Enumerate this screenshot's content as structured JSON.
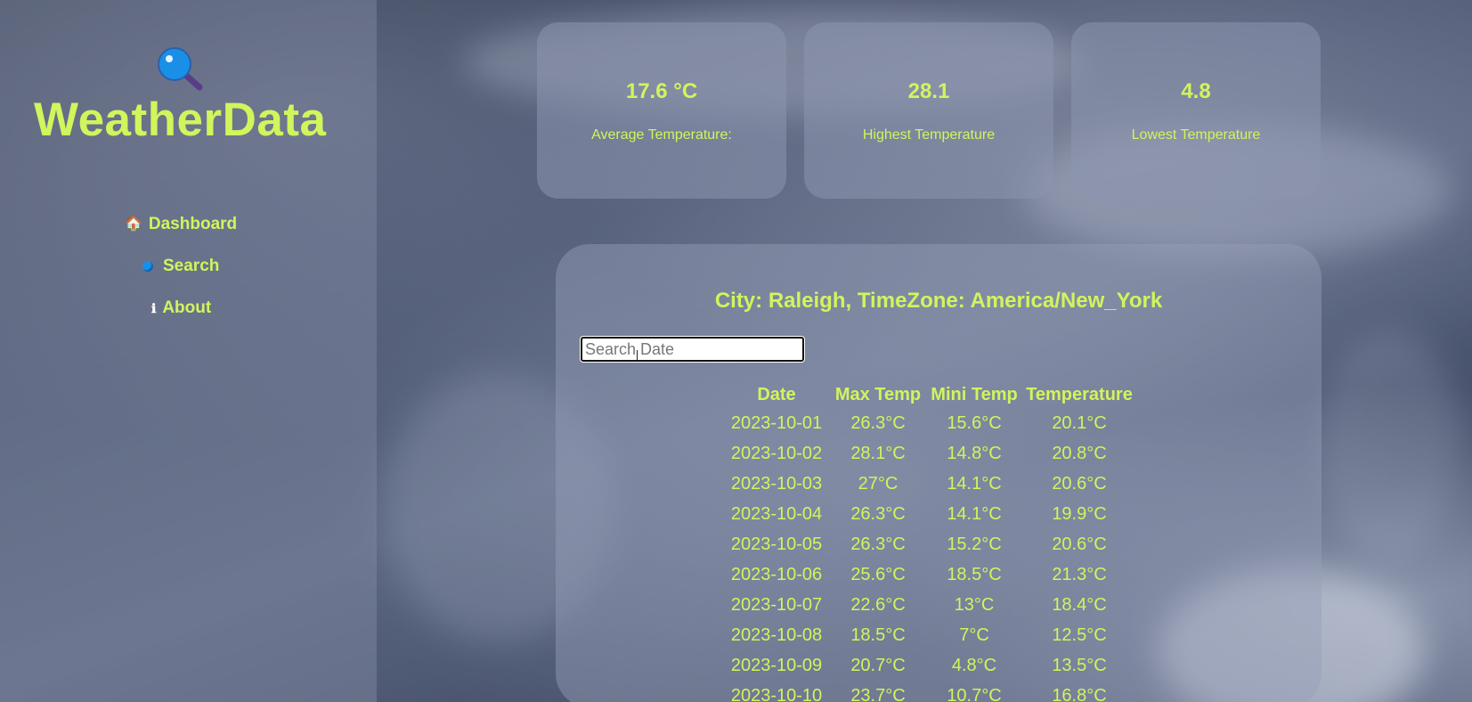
{
  "brand": {
    "name": "WeatherData",
    "icon": "magnifier-icon"
  },
  "nav": {
    "items": [
      {
        "icon": "🏠",
        "icon_name": "house-icon",
        "label": "Dashboard"
      },
      {
        "icon": "🔵",
        "icon_name": "blue-dot-icon",
        "label": "Search"
      },
      {
        "icon": "ℹ",
        "icon_name": "info-icon",
        "label": "About"
      }
    ]
  },
  "stats": [
    {
      "value": "17.6 °C",
      "label": "Average Temperature:"
    },
    {
      "value": "28.1",
      "label": "Highest Temperature"
    },
    {
      "value": "4.8",
      "label": "Lowest Temperature"
    }
  ],
  "main": {
    "title": "City: Raleigh, TimeZone: America/New_York",
    "search": {
      "placeholder": "Search Date",
      "value": ""
    },
    "table": {
      "headers": [
        "Date",
        "Max Temp",
        "Mini Temp",
        "Temperature"
      ],
      "rows": [
        [
          "2023-10-01",
          "26.3°C",
          "15.6°C",
          "20.1°C"
        ],
        [
          "2023-10-02",
          "28.1°C",
          "14.8°C",
          "20.8°C"
        ],
        [
          "2023-10-03",
          "27°C",
          "14.1°C",
          "20.6°C"
        ],
        [
          "2023-10-04",
          "26.3°C",
          "14.1°C",
          "19.9°C"
        ],
        [
          "2023-10-05",
          "26.3°C",
          "15.2°C",
          "20.6°C"
        ],
        [
          "2023-10-06",
          "25.6°C",
          "18.5°C",
          "21.3°C"
        ],
        [
          "2023-10-07",
          "22.6°C",
          "13°C",
          "18.4°C"
        ],
        [
          "2023-10-08",
          "18.5°C",
          "7°C",
          "12.5°C"
        ],
        [
          "2023-10-09",
          "20.7°C",
          "4.8°C",
          "13.5°C"
        ],
        [
          "2023-10-10",
          "23.7°C",
          "10.7°C",
          "16.8°C"
        ]
      ]
    }
  },
  "colors": {
    "accent": "#d2f45c",
    "sidebar_bg": "#6e7893",
    "panel_bg": "#8c96af"
  }
}
